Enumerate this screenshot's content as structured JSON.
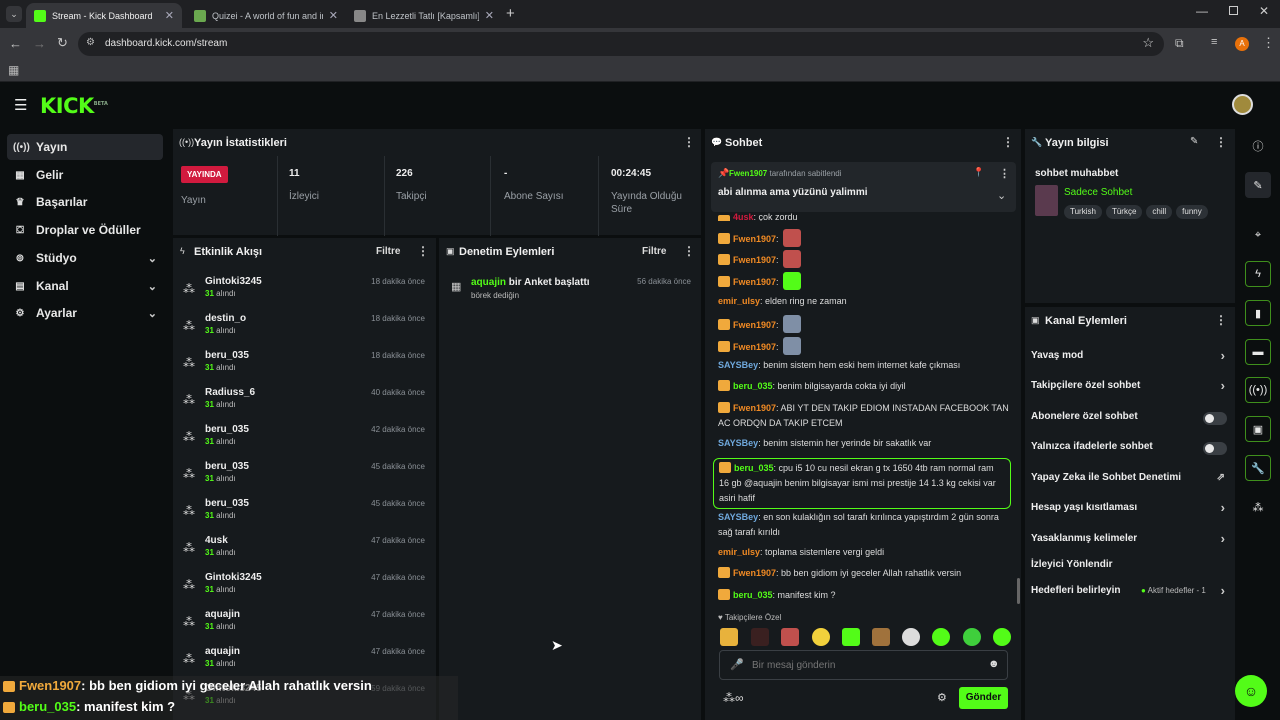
{
  "browser": {
    "tabs": [
      {
        "title": "Stream - Kick Dashboard",
        "favicon_color": "#53fc18"
      },
      {
        "title": "Quizei - A world of fun and inte",
        "favicon_color": "#6aa84f"
      },
      {
        "title": "En Lezzetli Tatlı [Kapsamlı] - Tie",
        "favicon_color": "#888888"
      }
    ],
    "url": "dashboard.kick.com/stream",
    "profile_letter": "A"
  },
  "app": {
    "logo": "KICK",
    "logo_badge": "BETA"
  },
  "sidebar": {
    "items": [
      {
        "label": "Yayın",
        "icon": "broadcast-icon",
        "glyph": "((•))"
      },
      {
        "label": "Gelir",
        "icon": "revenue-icon",
        "glyph": "▦"
      },
      {
        "label": "Başarılar",
        "icon": "trophy-icon",
        "glyph": "🏆"
      },
      {
        "label": "Droplar ve Ödüller",
        "icon": "drops-icon",
        "glyph": "⛋"
      },
      {
        "label": "Stüdyo",
        "icon": "studio-icon",
        "glyph": "⚙"
      },
      {
        "label": "Kanal",
        "icon": "channel-icon",
        "glyph": "▤"
      },
      {
        "label": "Ayarlar",
        "icon": "settings-icon",
        "glyph": "⚙"
      }
    ]
  },
  "stats": {
    "title": "Yayın İstatistikleri",
    "live_badge": "YAYINDA",
    "live_label": "Yayın",
    "viewers_value": "11",
    "viewers_label": "İzleyici",
    "followers_value": "226",
    "followers_label": "Takipçi",
    "subs_value": "-",
    "subs_label": "Abone Sayısı",
    "uptime_value": "00:24:45",
    "uptime_label": "Yayında Olduğu Süre"
  },
  "activity": {
    "title": "Etkinlik Akışı",
    "filter": "Filtre",
    "sub_count": "31",
    "sub_suffix": "alındı",
    "events": [
      {
        "name": "Gintoki3245",
        "time": "18 dakika önce"
      },
      {
        "name": "destin_o",
        "time": "18 dakika önce"
      },
      {
        "name": "beru_035",
        "time": "18 dakika önce"
      },
      {
        "name": "Radiuss_6",
        "time": "40 dakika önce"
      },
      {
        "name": "beru_035",
        "time": "42 dakika önce"
      },
      {
        "name": "beru_035",
        "time": "45 dakika önce"
      },
      {
        "name": "beru_035",
        "time": "45 dakika önce"
      },
      {
        "name": "4usk",
        "time": "47 dakika önce"
      },
      {
        "name": "Gintoki3245",
        "time": "47 dakika önce"
      },
      {
        "name": "aquajin",
        "time": "47 dakika önce"
      },
      {
        "name": "aquajin",
        "time": "47 dakika önce"
      },
      {
        "name": "Gintoki3245",
        "time": "59 dakika önce"
      }
    ]
  },
  "moderation": {
    "title": "Denetim Eylemleri",
    "filter": "Filtre",
    "actor": "aquajin",
    "action": "bir Anket başlattı",
    "detail": "börek dediğin",
    "time": "56 dakika önce"
  },
  "chat": {
    "title": "Sohbet",
    "pinned_by": "Fwen1907",
    "pinned_suffix": "tarafından sabitlendi",
    "pinned_text": "abi alınma ama yüzünü yalimmi",
    "top_cut_user": "4usk",
    "top_cut_text": ": çok zordu",
    "messages": [
      {
        "user": "Fwen1907",
        "color": "#f08a24",
        "crown": true,
        "text": ":",
        "emote": "#c0504d"
      },
      {
        "user": "Fwen1907",
        "color": "#f08a24",
        "crown": true,
        "text": ":",
        "emote": "#c0504d"
      },
      {
        "user": "Fwen1907",
        "color": "#f08a24",
        "crown": true,
        "text": ":",
        "emote": "#53fc18"
      },
      {
        "user": "emir_ulsy",
        "color": "#f08a24",
        "crown": false,
        "text": ": elden ring ne zaman"
      },
      {
        "user": "Fwen1907",
        "color": "#f08a24",
        "crown": true,
        "text": ":",
        "emote": "#7f8fa6"
      },
      {
        "user": "Fwen1907",
        "color": "#f08a24",
        "crown": true,
        "text": ":",
        "emote": "#7f8fa6"
      },
      {
        "user": "SAYSBey",
        "color": "#6fa8dc",
        "crown": false,
        "text": ": benim sistem hem eski hem internet kafe çıkması"
      },
      {
        "user": "beru_035",
        "color": "#53fc18",
        "crown": true,
        "text": ": benim bilgisayarda cokta iyi diyil"
      },
      {
        "user": "Fwen1907",
        "color": "#f08a24",
        "crown": true,
        "text": ": ABI YT DEN TAKIP EDIOM INSTADAN FACEBOOK TAN AC ORDQN DA TAKIP ETCEM"
      },
      {
        "user": "SAYSBey",
        "color": "#6fa8dc",
        "crown": false,
        "text": ": benim sistemin her yerinde bir sakatlık var"
      },
      {
        "user": "beru_035",
        "color": "#53fc18",
        "crown": true,
        "text": ": cpu i5 10 cu nesil ekran g tx 1650 4tb ram normal ram 16 gb @aquajin benim bilgisayar ismi msi prestije 14 1.3 kg cekisi var asiri hafif"
      },
      {
        "user": "SAYSBey",
        "color": "#6fa8dc",
        "crown": false,
        "text": ": en son kulaklığın sol tarafı kırılınca yapıştırdım 2 gün sonra sağ tarafı kırıldı"
      },
      {
        "user": "emir_ulsy",
        "color": "#f08a24",
        "crown": false,
        "text": ": toplama sistemlere vergi geldi"
      },
      {
        "user": "Fwen1907",
        "color": "#f08a24",
        "crown": true,
        "text": ": bb ben gidiom iyi geceler Allah rahatlık versin"
      },
      {
        "user": "beru_035",
        "color": "#53fc18",
        "crown": true,
        "text": ": manifest kim ?"
      }
    ],
    "followers_only": "Takipçilere Özel",
    "input_placeholder": "Bir mesaj gönderin",
    "send_label": "Gönder"
  },
  "stream_info": {
    "title": "Yayın bilgisi",
    "stream_title": "sohbet muhabbet",
    "category": "Sadece Sohbet",
    "tags": [
      "Turkish",
      "Türkçe",
      "chill",
      "funny"
    ]
  },
  "channel_actions": {
    "title": "Kanal Eylemleri",
    "items": [
      {
        "label": "Yavaş mod",
        "control": "arrow"
      },
      {
        "label": "Takipçilere özel sohbet",
        "control": "arrow"
      },
      {
        "label": "Abonelere özel sohbet",
        "control": "toggle"
      },
      {
        "label": "Yalnızca ifadelerle sohbet",
        "control": "toggle"
      },
      {
        "label": "Yapay Zeka ile Sohbet Denetimi",
        "control": "external"
      },
      {
        "label": "Hesap yaşı kısıtlaması",
        "control": "arrow"
      },
      {
        "label": "Yasaklanmış kelimeler",
        "control": "arrow"
      },
      {
        "label": "İzleyici Yönlendir",
        "control": "none"
      },
      {
        "label": "Hedefleri belirleyin",
        "control": "arrow"
      }
    ],
    "goals_status": "Aktif hedefler - 1"
  },
  "overlay": {
    "lines": [
      {
        "user": "Fwen1907",
        "text": ": bb ben gidiom iyi geceler Allah rahatlık versin",
        "color": "#f0a93c"
      },
      {
        "user": "beru_035",
        "text": ": manifest kim ?",
        "color": "#53fc18"
      }
    ]
  }
}
